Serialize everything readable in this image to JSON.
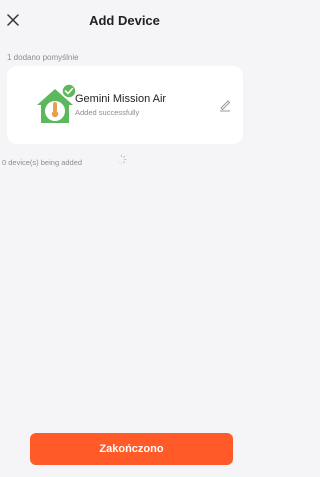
{
  "header": {
    "title": "Add Device",
    "close_icon": "close-icon"
  },
  "added_section": {
    "label": "1 dodano pomyślnie"
  },
  "device": {
    "name": "Gemini Mission Air",
    "status": "Added successfully",
    "icon": "thermometer-house-icon",
    "badge_icon": "check-badge-icon",
    "edit_icon": "pencil-icon"
  },
  "pending": {
    "label": "0 device(s) being added",
    "spinner_icon": "loading-spinner-icon"
  },
  "footer": {
    "finish_label": "Zakończono"
  },
  "colors": {
    "accent": "#ff5a28",
    "device_green": "#5cb85c",
    "background": "#f5f5f7"
  }
}
